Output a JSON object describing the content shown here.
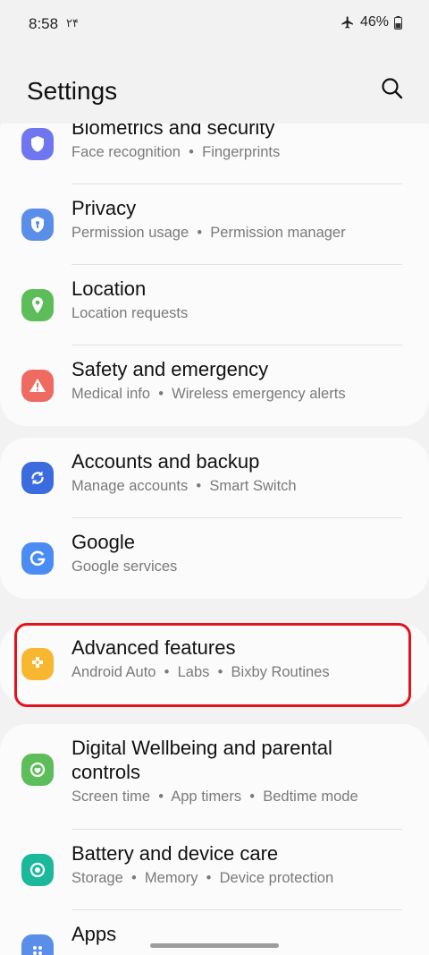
{
  "status_bar": {
    "time": "8:58",
    "extra": "۲۴",
    "battery": "46%"
  },
  "header": {
    "title": "Settings"
  },
  "groups": [
    {
      "items": [
        {
          "title": "Biometrics and security",
          "subtitle": [
            "Face recognition",
            "Fingerprints"
          ],
          "icon": "shield-icon",
          "color": "#7076f0"
        },
        {
          "title": "Privacy",
          "subtitle": [
            "Permission usage",
            "Permission manager"
          ],
          "icon": "privacy-shield-icon",
          "color": "#5b8ee9"
        },
        {
          "title": "Location",
          "subtitle": [
            "Location requests"
          ],
          "icon": "location-pin-icon",
          "color": "#5ebd5b"
        },
        {
          "title": "Safety and emergency",
          "subtitle": [
            "Medical info",
            "Wireless emergency alerts"
          ],
          "icon": "alert-icon",
          "color": "#ef6a60"
        }
      ]
    },
    {
      "items": [
        {
          "title": "Accounts and backup",
          "subtitle": [
            "Manage accounts",
            "Smart Switch"
          ],
          "icon": "sync-icon",
          "color": "#3c6be0"
        },
        {
          "title": "Google",
          "subtitle": [
            "Google services"
          ],
          "icon": "google-icon",
          "color": "#4a8cf4"
        }
      ]
    },
    {
      "items": [
        {
          "title": "Advanced features",
          "subtitle": [
            "Android Auto",
            "Labs",
            "Bixby Routines"
          ],
          "icon": "advanced-features-icon",
          "color": "#f7b731"
        }
      ]
    },
    {
      "items": [
        {
          "title": "Digital Wellbeing and parental controls",
          "subtitle": [
            "Screen time",
            "App timers",
            "Bedtime mode"
          ],
          "icon": "wellbeing-icon",
          "color": "#5ebd5b"
        },
        {
          "title": "Battery and device care",
          "subtitle": [
            "Storage",
            "Memory",
            "Device protection"
          ],
          "icon": "device-care-icon",
          "color": "#1cb89c"
        },
        {
          "title": "Apps",
          "subtitle": [],
          "icon": "apps-icon",
          "color": "#5b8ee9"
        }
      ]
    }
  ],
  "highlight_color": "#e2131b"
}
